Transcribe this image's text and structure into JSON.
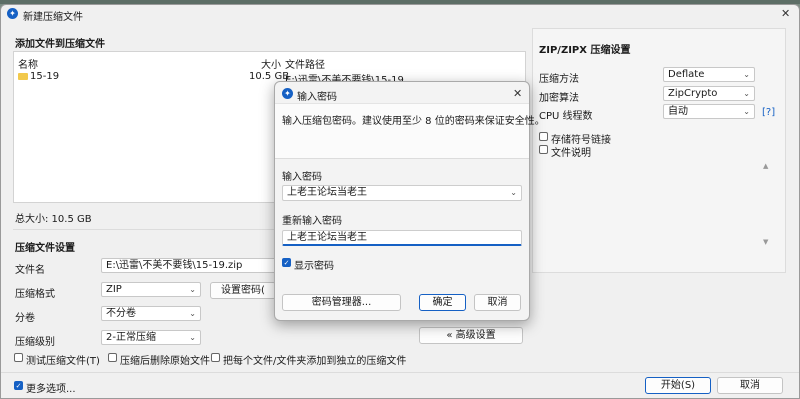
{
  "main": {
    "title": "新建压缩文件",
    "close_glyph": "✕",
    "add_files_heading": "添加文件到压缩文件",
    "columns": {
      "name": "名称",
      "size": "大小",
      "path": "文件路径"
    },
    "files": [
      {
        "name": "15-19",
        "size": "10.5 GB",
        "path": "E:\\迅雷\\不美不要钱\\15-19"
      }
    ],
    "total_size": "总大小: 10.5 GB",
    "settings_heading": "压缩文件设置",
    "filename_label": "文件名",
    "filename_value": "E:\\迅雷\\不美不要钱\\15-19.zip",
    "format_label": "压缩格式",
    "format_value": "ZIP",
    "set_password_button": "设置密码(",
    "split_label": "分卷",
    "split_value": "不分卷",
    "level_label": "压缩级别",
    "level_value": "2-正常压缩",
    "advanced_button": "« 高级设置",
    "test_archive": "测试压缩文件(T)",
    "delete_after": "压缩后删除原始文件",
    "separate_archives": "把每个文件/文件夹添加到独立的压缩文件",
    "more_options": "更多选项...",
    "start_button": "开始(S)",
    "cancel_button": "取消"
  },
  "zip_settings": {
    "heading": "ZIP/ZIPX 压缩设置",
    "method_label": "压缩方法",
    "method_value": "Deflate",
    "encryption_label": "加密算法",
    "encryption_value": "ZipCrypto",
    "threads_label": "CPU 线程数",
    "threads_value": "自动",
    "help_link": "[?]",
    "store_symlinks": "存储符号链接",
    "file_comment": "文件说明"
  },
  "dialog": {
    "title": "输入密码",
    "close_glyph": "✕",
    "hint": "输入压缩包密码。建议使用至少 8 位的密码来保证安全性。",
    "password_label": "输入密码",
    "password_value": "上老王论坛当老王",
    "confirm_label": "重新输入密码",
    "confirm_value": "上老王论坛当老王",
    "show_password": "显示密码",
    "password_manager_button": "密码管理器...",
    "ok_button": "确定",
    "cancel_button": "取消"
  },
  "colors": {
    "accent": "#1560c4",
    "folder": "#f2c94c"
  }
}
